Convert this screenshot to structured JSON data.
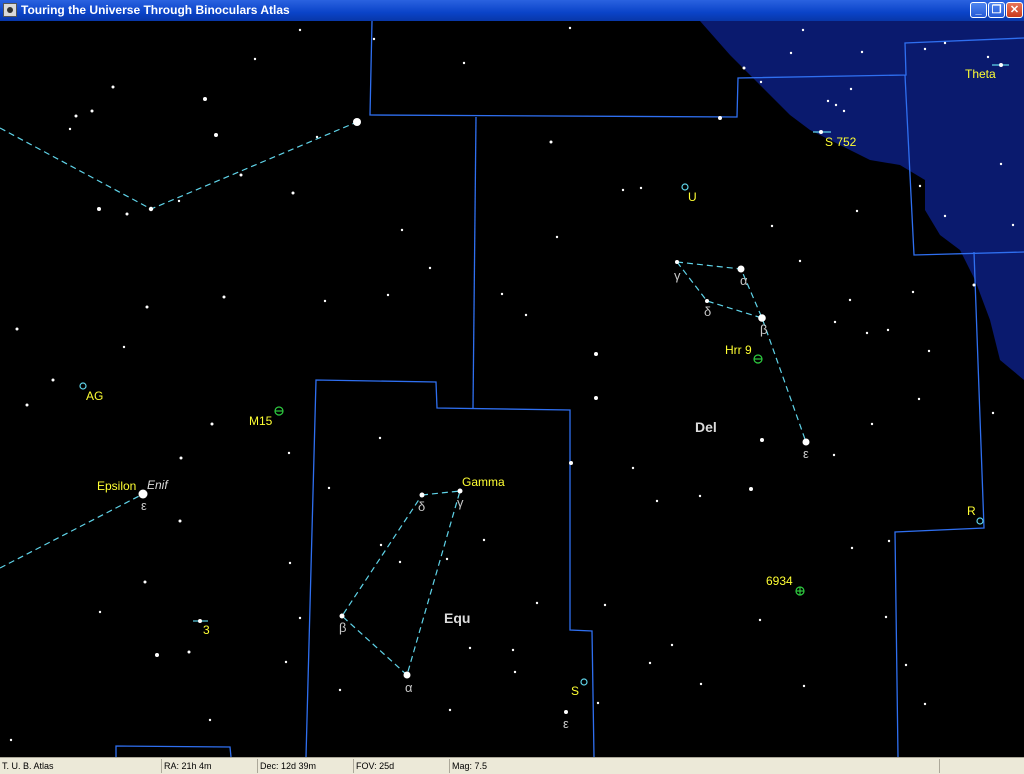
{
  "window": {
    "title": "Touring the Universe Through Binoculars Atlas",
    "minimize_glyph": "_",
    "maximize_glyph": "❐",
    "close_glyph": "✕"
  },
  "map": {
    "background": "#000000",
    "milky_way_color": "#0a1a6e",
    "boundary_color": "#2f6ff0",
    "figure_color": "#5fd3e8",
    "star_color": "#ffffff",
    "label_color": "#ffff33",
    "constellations": {
      "del": "Del",
      "equ": "Equ"
    },
    "object_labels": {
      "theta": "Theta",
      "s752": "S 752",
      "u": "U",
      "ag": "AG",
      "m15": "M15",
      "hrr9": "Hrr 9",
      "epsilon": "Epsilon",
      "gamma": "Gamma",
      "three": "3",
      "r": "R",
      "n6934": "6934",
      "s": "S"
    },
    "star_name_enif": "Enif",
    "greek": {
      "del_gamma": "γ",
      "del_alpha": "α",
      "del_delta": "δ",
      "del_beta": "β",
      "del_epsilon": "ε",
      "peg_epsilon": "ε",
      "equ_delta": "δ",
      "equ_gamma": "γ",
      "equ_beta": "β",
      "equ_alpha": "α",
      "equ_epsilon": "ε"
    }
  },
  "status": {
    "app": "T. U. B. Atlas",
    "ra": "RA: 21h 4m",
    "dec": "Dec: 12d 39m",
    "fov": "FOV: 25d",
    "mag": "Mag: 7.5"
  }
}
